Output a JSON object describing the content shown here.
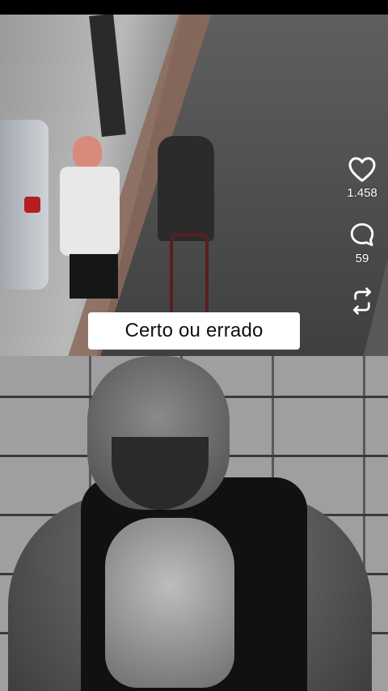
{
  "video": {
    "caption": "Certo ou errado"
  },
  "actions": {
    "likes": "1.458",
    "comments": "59"
  },
  "icons": {
    "like": "heart-icon",
    "comment": "comment-bubble-icon",
    "repost": "repost-icon"
  }
}
